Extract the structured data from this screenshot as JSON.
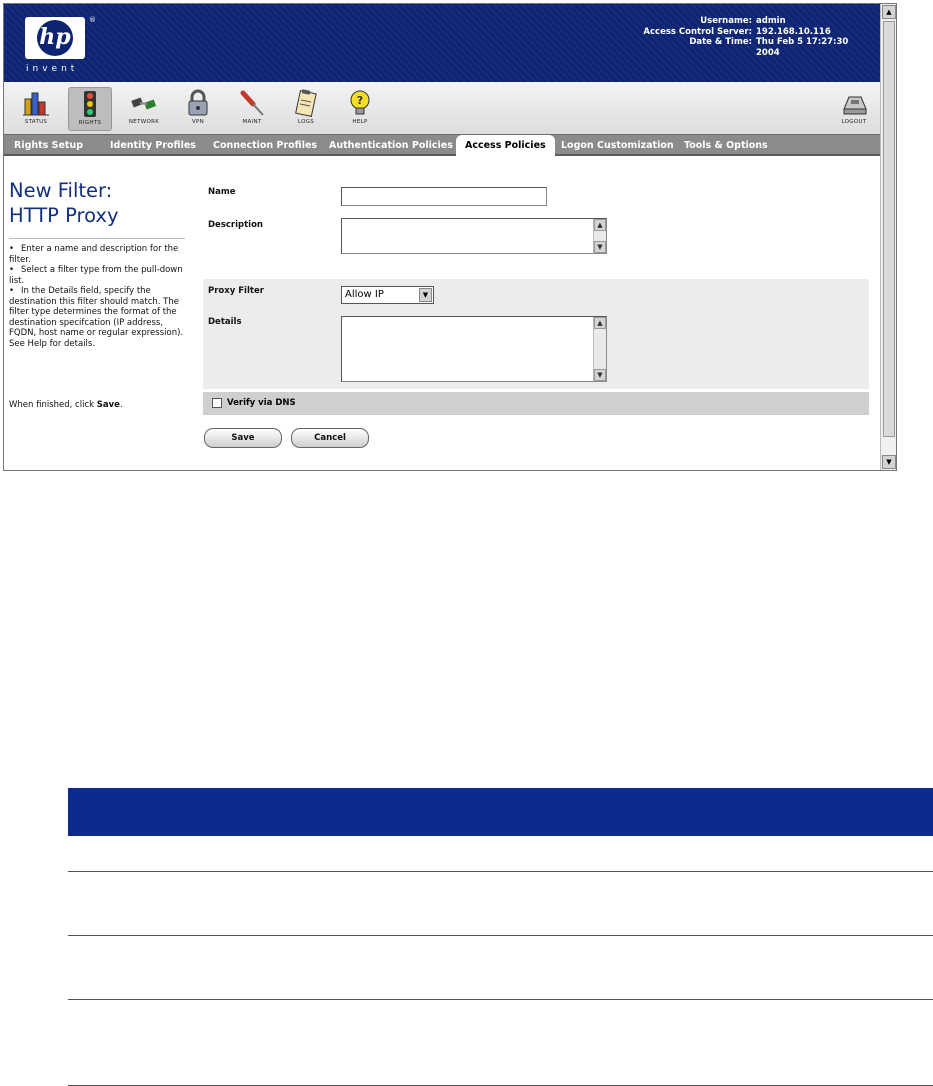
{
  "header": {
    "logo_text": "hp",
    "logo_reg": "®",
    "tagline": "invent",
    "info": [
      {
        "label": "Username:",
        "value": "admin"
      },
      {
        "label": "Access Control Server:",
        "value": "192.168.10.116"
      },
      {
        "label": "Date & Time:",
        "value": "Thu Feb 5 17:27:30 2004"
      }
    ]
  },
  "toolbar": {
    "items": [
      {
        "label": "STATUS",
        "icon": "bar-chart-icon",
        "active": false
      },
      {
        "label": "RIGHTS",
        "icon": "traffic-light-icon",
        "active": true
      },
      {
        "label": "NETWORK",
        "icon": "network-icon",
        "active": false
      },
      {
        "label": "VPN",
        "icon": "padlock-icon",
        "active": false
      },
      {
        "label": "MAINT",
        "icon": "screwdriver-icon",
        "active": false
      },
      {
        "label": "LOGS",
        "icon": "clipboard-icon",
        "active": false
      },
      {
        "label": "HELP",
        "icon": "lightbulb-help-icon",
        "active": false
      }
    ],
    "logout_label": "LOGOUT",
    "logout_icon": "logout-device-icon"
  },
  "tabs": [
    {
      "label": "Rights Setup",
      "active": false
    },
    {
      "label": "Identity Profiles",
      "active": false
    },
    {
      "label": "Connection Profiles",
      "active": false
    },
    {
      "label": "Authentication Policies",
      "active": false
    },
    {
      "label": "Access Policies",
      "active": true
    },
    {
      "label": "Logon Customization",
      "active": false
    },
    {
      "label": "Tools & Options",
      "active": false
    }
  ],
  "sidebar": {
    "title": "New Filter:\nHTTP Proxy",
    "bullets": [
      "Enter a name and description for the filter.",
      "Select a filter type from the pull-down list.",
      "In the Details field, specify the destination this filter should match. The filter type determines the format of the destination specifcation (IP address, FQDN, host name or regular expression). See Help for details."
    ],
    "finish_prefix": "When finished, click ",
    "finish_bold": "Save",
    "finish_suffix": "."
  },
  "form": {
    "name_label": "Name",
    "name_value": "",
    "description_label": "Description",
    "description_value": "",
    "proxy_filter_label": "Proxy Filter",
    "proxy_filter_value": "Allow IP",
    "details_label": "Details",
    "details_value": "",
    "verify_dns_label": "Verify via DNS",
    "verify_dns_checked": false,
    "save_label": "Save",
    "cancel_label": "Cancel"
  },
  "colors": {
    "header_bg": "#0d2473",
    "title_blue": "#12307c",
    "tab_bar": "#8b8b8b",
    "table_header": "#0d2a90"
  }
}
